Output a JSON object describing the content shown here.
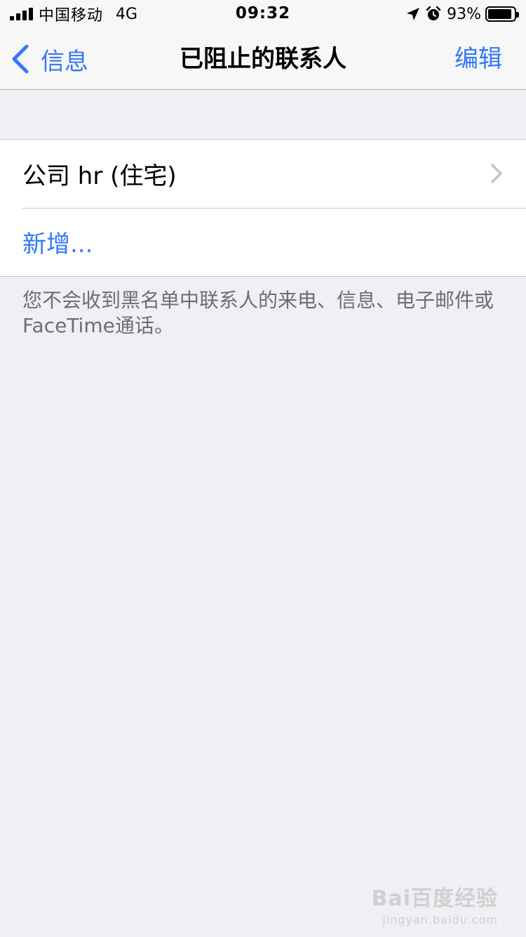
{
  "status_bar": {
    "carrier": "中国移动",
    "network": "4G",
    "time": "09:32",
    "battery_percent": "93%",
    "battery_level": 0.93,
    "icons": [
      "signal-icon",
      "location-arrow-icon",
      "alarm-clock-icon",
      "battery-icon"
    ]
  },
  "nav": {
    "back_label": "信息",
    "title": "已阻止的联系人",
    "edit_label": "编辑"
  },
  "list": {
    "contact_label": "公司 hr (住宅)",
    "add_label": "新增..."
  },
  "footnote": "您不会收到黑名单中联系人的来电、信息、电子邮件或FaceTime通话。",
  "watermark": {
    "main": "Bai百度经验",
    "sub": "jingyan.baidu.com"
  },
  "colors": {
    "accent": "#3478f6",
    "background": "#efeff4",
    "secondary_text": "#6d6d72"
  }
}
